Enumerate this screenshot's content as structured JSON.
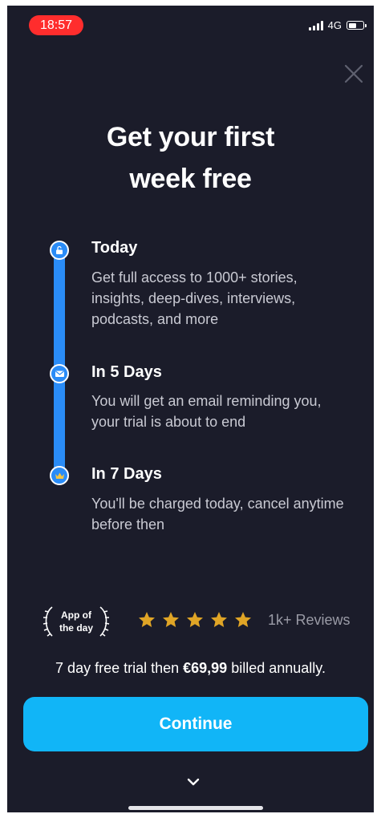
{
  "status_bar": {
    "time": "18:57",
    "network": "4G"
  },
  "header": {
    "title_line1": "Get your first",
    "title_line2": "week free"
  },
  "timeline": [
    {
      "icon": "unlock-icon",
      "title": "Today",
      "description": "Get full access to 1000+ stories, insights, deep-dives, interviews, podcasts, and more"
    },
    {
      "icon": "mail-icon",
      "title": "In 5 Days",
      "description": "You will get an email reminding you, your trial is about to end"
    },
    {
      "icon": "crown-icon",
      "title": "In 7 Days",
      "description": "You'll be charged today, cancel anytime before then"
    }
  ],
  "rating": {
    "badge_line1": "App of",
    "badge_line2": "the day",
    "stars": 5,
    "reviews": "1k+ Reviews",
    "star_color": "#e0a526"
  },
  "offer": {
    "prefix": "7 day free trial then ",
    "price": "€69,99",
    "suffix": " billed annually."
  },
  "cta": {
    "label": "Continue",
    "color": "#11b5f7"
  },
  "colors": {
    "background": "#1b1c2a",
    "timeline": "#2a8cf7"
  }
}
